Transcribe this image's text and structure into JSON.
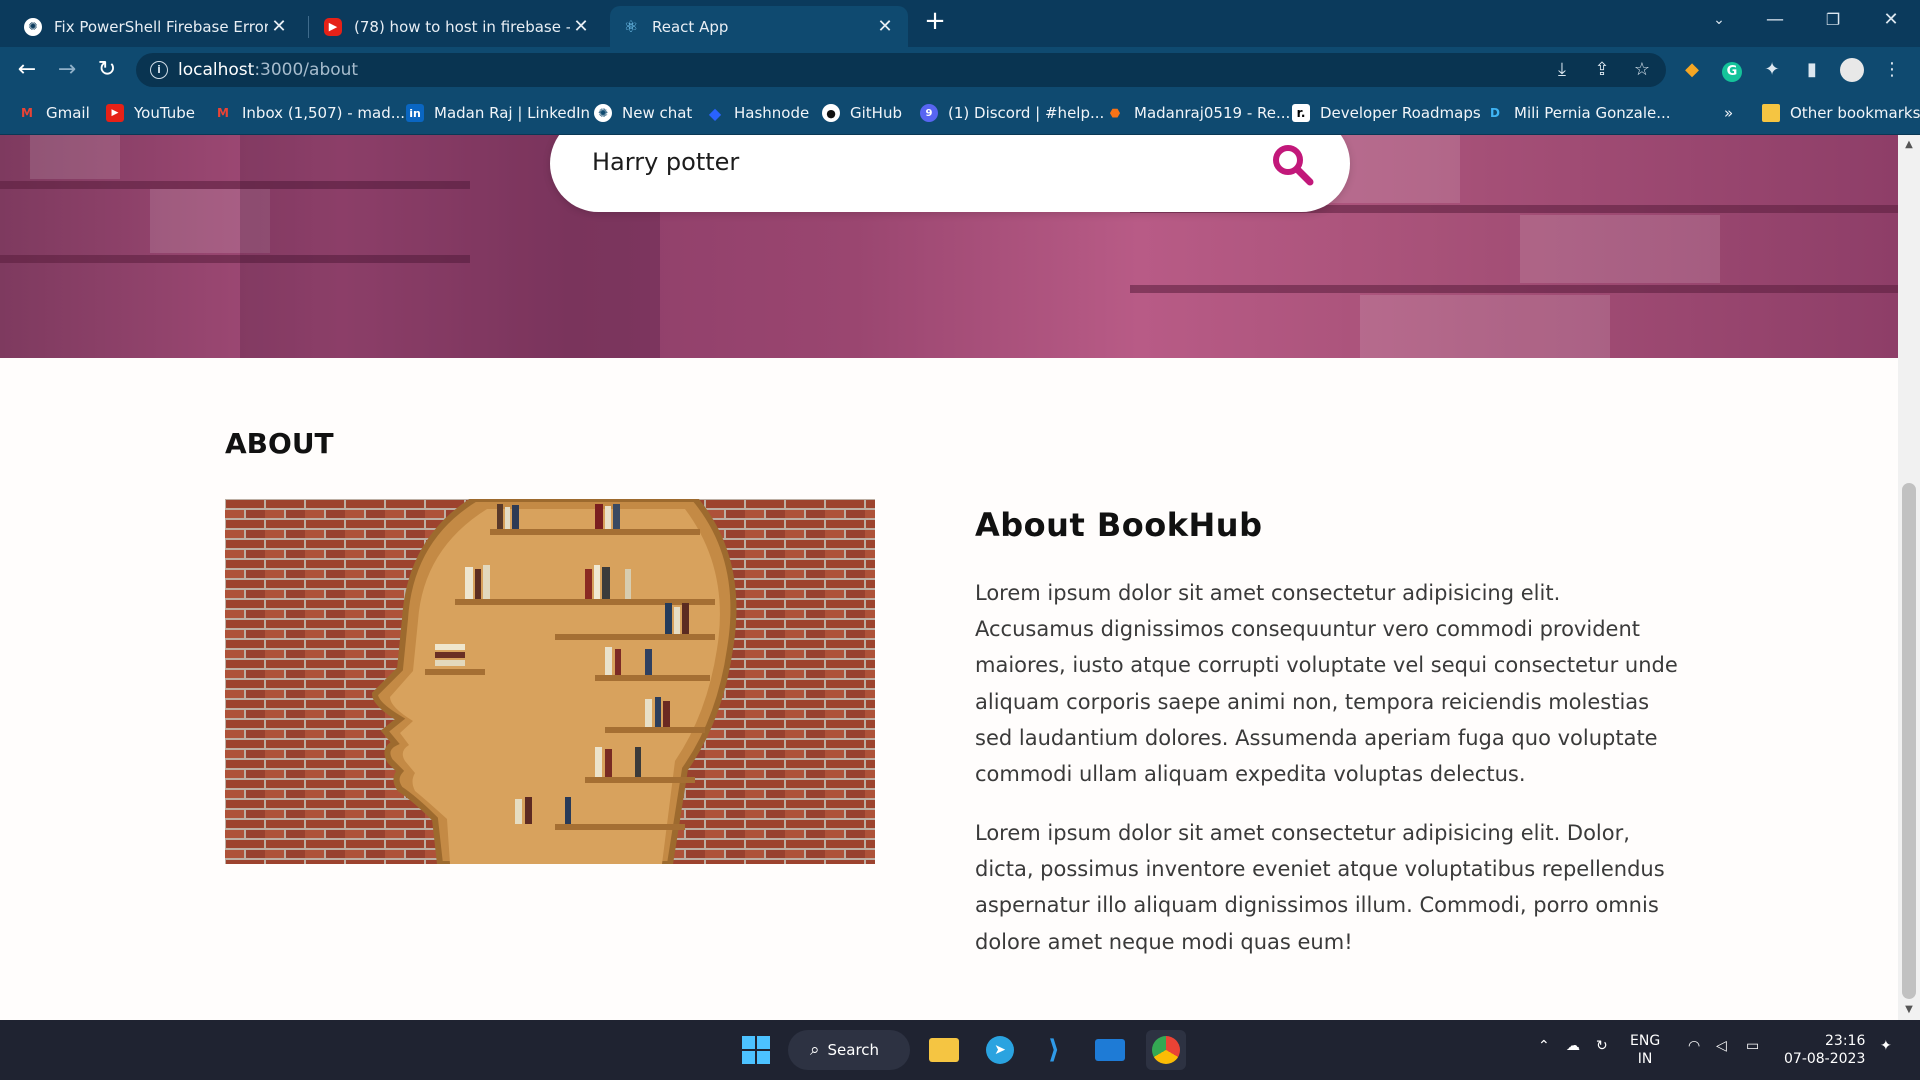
{
  "browser": {
    "tabs": [
      {
        "title": "Fix PowerShell Firebase Error",
        "icon": "chatgpt-icon"
      },
      {
        "title": "(78) how to host in firebase - You",
        "icon": "youtube-icon"
      },
      {
        "title": "React App",
        "icon": "react-icon"
      }
    ],
    "url_host": "localhost",
    "url_path": ":3000/about",
    "bookmarks": [
      "Gmail",
      "YouTube",
      "Inbox (1,507) - mad...",
      "Madan Raj | LinkedIn",
      "New chat",
      "Hashnode",
      "GitHub",
      "(1) Discord | #help...",
      "Madanraj0519 - Re...",
      "Developer Roadmaps",
      "Mili Pernia Gonzale..."
    ],
    "more_bookmarks": "»",
    "other_bookmarks": "Other bookmarks"
  },
  "page": {
    "search_value": "Harry potter",
    "about_heading": "ABOUT",
    "about_title": "About BookHub",
    "paragraph1": "Lorem ipsum dolor sit amet consectetur adipisicing elit. Accusamus dignissimos consequuntur vero commodi provident maiores, iusto atque corrupti voluptate vel sequi consectetur unde aliquam corporis saepe animi non, tempora reiciendis molestias sed laudantium dolores. Assumenda aperiam fuga quo voluptate commodi ullam aliquam expedita voluptas delectus.",
    "paragraph2": "Lorem ipsum dolor sit amet consectetur adipisicing elit. Dolor, dicta, possimus inventore eveniet atque voluptatibus repellendus aspernatur illo aliquam dignissimos illum. Commodi, porro omnis dolore amet neque modi quas eum!"
  },
  "taskbar": {
    "search_label": "Search",
    "lang_top": "ENG",
    "lang_bottom": "IN",
    "time": "23:16",
    "date": "07-08-2023"
  },
  "colors": {
    "accent_pink": "#c2187a",
    "chrome_dark": "#0b3a5c",
    "chrome": "#0f4a70"
  }
}
